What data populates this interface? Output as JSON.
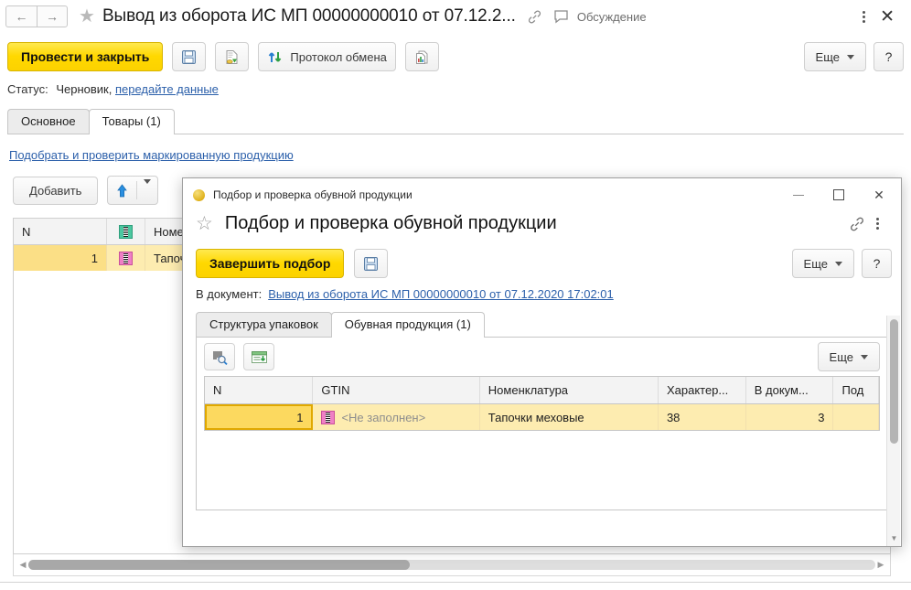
{
  "main_window": {
    "title": "Вывод из оборота ИС МП 00000000010 от 07.12.2...",
    "nav_back_icon": "arrow-left-icon",
    "nav_forward_icon": "arrow-right-icon",
    "favorite_icon": "star-icon",
    "link_icon": "link-icon",
    "discussion_icon": "comment-icon",
    "discussion_label": "Обсуждение",
    "menu_icon": "kebab-menu-icon",
    "close_icon": "close-icon",
    "toolbar": {
      "post_and_close": "Провести и закрыть",
      "save_icon": "floppy-disk-icon",
      "write_icon": "document-write-icon",
      "exchange_protocol": "Протокол обмена",
      "exchange_icon": "up-down-arrows-icon",
      "report_icon": "report-chart-icon",
      "more_label": "Еще",
      "help_label": "?"
    },
    "status": {
      "label": "Статус:",
      "value": "Черновик,",
      "action_link": "передайте данные"
    },
    "tabs": [
      {
        "label": "Основное",
        "active": false
      },
      {
        "label": "Товары (1)",
        "active": true
      }
    ],
    "pick_link": "Подобрать и проверить маркированную продукцию",
    "sub_toolbar": {
      "add_label": "Добавить",
      "upload_icon": "up-arrow-icon"
    },
    "grid": {
      "columns": [
        "N",
        "",
        "Номенклатура"
      ],
      "column_icon": "marking-code-green-icon",
      "rows": [
        {
          "n": "1",
          "icon": "marking-code-pink-icon",
          "nomenclature": "Тапочки меховые"
        }
      ]
    },
    "hscroll": {
      "left_arrow": "◀",
      "right_arrow": "▶",
      "thumb_percent": "45"
    }
  },
  "dialog": {
    "titlebar_icon": "yellow-circle-icon",
    "titlebar_text": "Подбор и проверка обувной продукции",
    "minimize_icon": "minimize-icon",
    "maximize_icon": "maximize-icon",
    "close_icon": "close-icon",
    "favorite_icon": "star-icon",
    "heading": "Подбор и проверка обувной продукции",
    "link_icon": "link-icon",
    "menu_icon": "kebab-menu-icon",
    "toolbar": {
      "finish_label": "Завершить подбор",
      "save_icon": "floppy-disk-icon",
      "more_label": "Еще",
      "help_label": "?"
    },
    "doc_line": {
      "label": "В документ:",
      "link": "Вывод из оборота ИС МП 00000000010 от 07.12.2020 17:02:01"
    },
    "tabs": [
      {
        "label": "Структура упаковок",
        "active": false
      },
      {
        "label": "Обувная продукция (1)",
        "active": true
      }
    ],
    "panel_toolbar": {
      "barcode_scan_icon": "barcode-search-icon",
      "fill_table_icon": "table-import-green-icon",
      "more_label": "Еще"
    },
    "grid": {
      "columns": [
        "N",
        "GTIN",
        "Номенклатура",
        "Характер...",
        "В докум...",
        "Под"
      ],
      "rows": [
        {
          "n": "1",
          "gtin_icon": "marking-code-pink-icon",
          "gtin": "<Не заполнен>",
          "nomenclature": "Тапочки меховые",
          "characteristic": "38",
          "in_document": "3",
          "pod": ""
        }
      ]
    },
    "vscroll": {
      "down_arrow": "▼"
    }
  },
  "colors": {
    "accent_yellow": "#ffd800",
    "link_blue": "#2b5faa",
    "row_highlight": "#fdecb0",
    "cell_selected": "#fcd95f"
  }
}
